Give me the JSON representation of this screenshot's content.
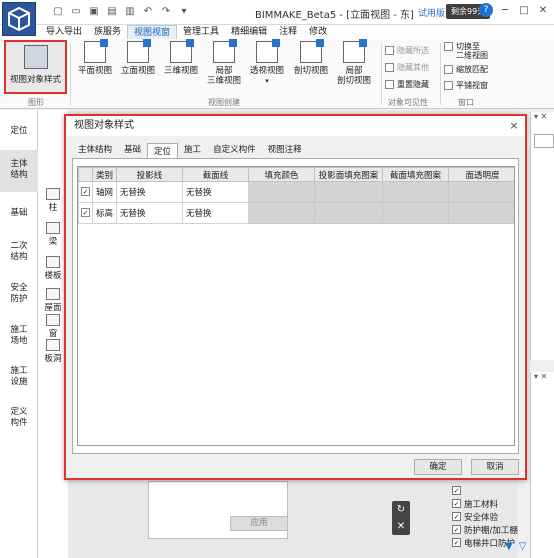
{
  "app": {
    "title": "BIMMAKE_Beta5 - [立面视图 - 东]",
    "trial_label": "试用版",
    "days_left": "剩余99天",
    "help_label": "?"
  },
  "menu": {
    "items": [
      "导入导出",
      "族服务",
      "视图视窗",
      "管理工具",
      "精细编辑",
      "注释",
      "修改"
    ],
    "active_index": 2
  },
  "ribbon": {
    "style_button": "视图对象样式",
    "group_graphics": "图形",
    "view_buttons": [
      "平面视图",
      "立面视图",
      "三维视图",
      "局部\n三维视图",
      "透视视图",
      "剖切视图",
      "局部\n剖切视图"
    ],
    "group_view_create": "视图创建",
    "visibility": {
      "hide_selected": "隐藏所选",
      "hide_other": "隐藏其他",
      "reset_hidden": "重置隐藏"
    },
    "group_visibility": "对象可见性",
    "window": {
      "switch_2d_3d": "切换至\n二维视图",
      "zoom_fit": "缩放匹配",
      "tile": "平铺视窗"
    },
    "group_window": "窗口"
  },
  "left_rail": [
    "定位",
    "主体\n结构",
    "基础",
    "二次\n结构",
    "安全\n防护",
    "施工\n场地",
    "施工\n设施",
    "定义\n构件"
  ],
  "left_rail_active": 1,
  "component_panel": [
    "柱",
    "梁",
    "楼板",
    "屋面",
    "窗",
    "板洞"
  ],
  "dialog": {
    "title": "视图对象样式",
    "close_icon": "×",
    "tabs": [
      "主体结构",
      "基础",
      "定位",
      "施工",
      "自定义构件",
      "视图注释"
    ],
    "active_tab": 2,
    "columns": [
      "",
      "类别",
      "投影线",
      "截面线",
      "填充颜色",
      "投影面填充图案",
      "截面填充图案",
      "面透明度"
    ],
    "rows": [
      {
        "checked": true,
        "category": "轴网",
        "projection_line": "无替换",
        "section_line": "无替换"
      },
      {
        "checked": true,
        "category": "标高",
        "projection_line": "无替换",
        "section_line": "无替换"
      }
    ],
    "ok_label": "确定",
    "cancel_label": "取消"
  },
  "apply_label": "应用",
  "checklist": [
    {
      "label": "",
      "checked": true
    },
    {
      "label": "施工材料",
      "checked": true
    },
    {
      "label": "安全体验",
      "checked": true
    },
    {
      "label": "防护棚/加工棚",
      "checked": true
    },
    {
      "label": "电梯井口防护",
      "checked": true
    }
  ],
  "colors": {
    "accent_blue": "#1a73d0",
    "highlight_red": "#e03030",
    "grey_cell": "#d4d4d4"
  }
}
